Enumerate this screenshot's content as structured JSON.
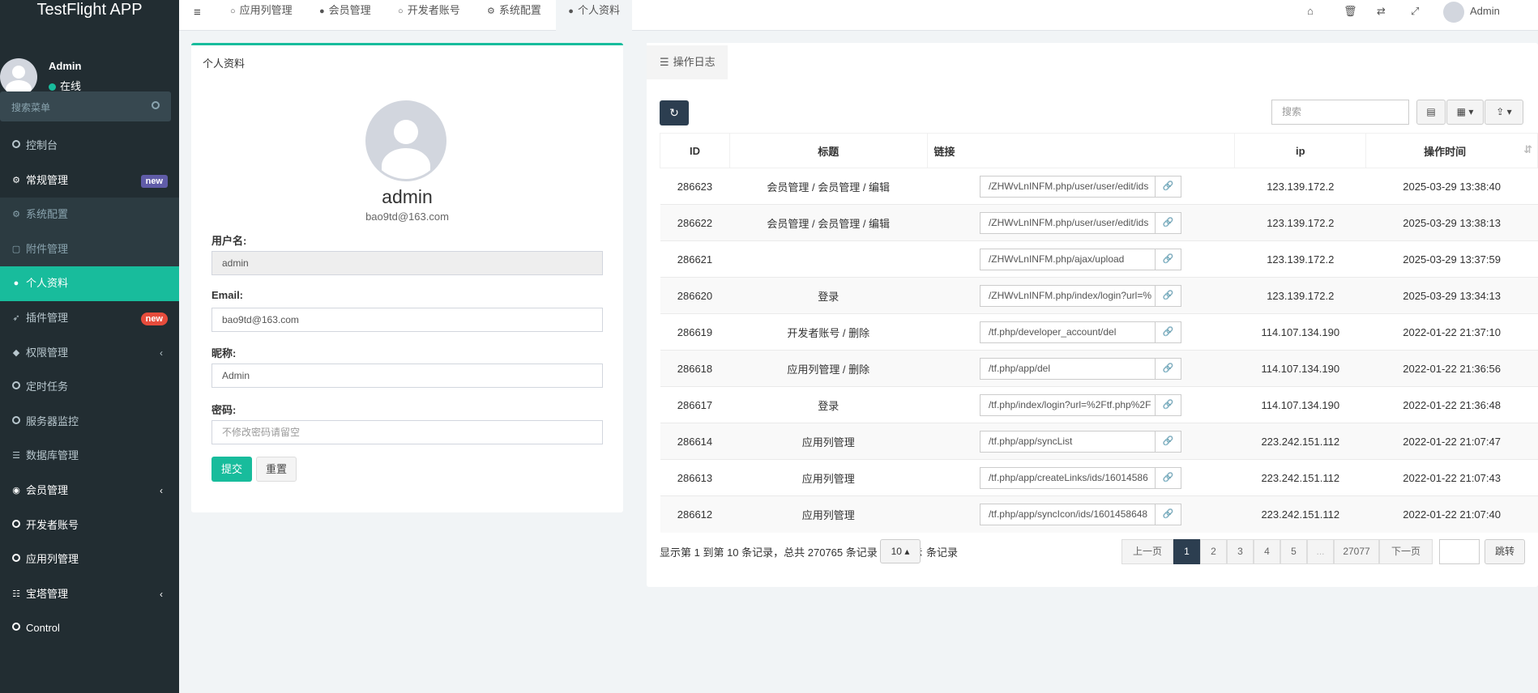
{
  "app": {
    "title": "TestFlight APP"
  },
  "user": {
    "name": "Admin",
    "status": "在线"
  },
  "sidebar": {
    "search_placeholder": "搜索菜单",
    "items": [
      {
        "label": "控制台"
      },
      {
        "label": "常规管理",
        "badge": "new"
      },
      {
        "label": "系统配置"
      },
      {
        "label": "附件管理"
      },
      {
        "label": "个人资料"
      },
      {
        "label": "插件管理",
        "badge": "new"
      },
      {
        "label": "权限管理"
      },
      {
        "label": "定时任务"
      },
      {
        "label": "服务器监控"
      },
      {
        "label": "数据库管理"
      },
      {
        "label": "会员管理"
      },
      {
        "label": "开发者账号"
      },
      {
        "label": "应用列管理"
      },
      {
        "label": "宝塔管理"
      },
      {
        "label": "Control"
      }
    ]
  },
  "tabs": [
    "应用列管理",
    "会员管理",
    "开发者账号",
    "系统配置",
    "个人资料"
  ],
  "topbar": {
    "username": "Admin"
  },
  "profile": {
    "header": "个人资料",
    "display_name": "admin",
    "email_caption": "bao9td@163.com",
    "fields": {
      "username_label": "用户名:",
      "username_value": "admin",
      "email_label": "Email:",
      "email_value": "bao9td@163.com",
      "nickname_label": "昵称:",
      "nickname_value": "Admin",
      "password_label": "密码:",
      "password_placeholder": "不修改密码请留空"
    },
    "submit_label": "提交",
    "reset_label": "重置"
  },
  "log": {
    "tab_label": "操作日志",
    "search_placeholder": "搜索",
    "columns": [
      "ID",
      "标题",
      "链接",
      "ip",
      "操作时间"
    ],
    "rows": [
      {
        "id": "286623",
        "title": "会员管理 / 会员管理 / 编辑",
        "url": "/ZHWvLnINFM.php/user/user/edit/ids",
        "ip": "123.139.172.2",
        "time": "2025-03-29 13:38:40"
      },
      {
        "id": "286622",
        "title": "会员管理 / 会员管理 / 编辑",
        "url": "/ZHWvLnINFM.php/user/user/edit/ids",
        "ip": "123.139.172.2",
        "time": "2025-03-29 13:38:13"
      },
      {
        "id": "286621",
        "title": "",
        "url": "/ZHWvLnINFM.php/ajax/upload",
        "ip": "123.139.172.2",
        "time": "2025-03-29 13:37:59"
      },
      {
        "id": "286620",
        "title": "登录",
        "url": "/ZHWvLnINFM.php/index/login?url=%",
        "ip": "123.139.172.2",
        "time": "2025-03-29 13:34:13"
      },
      {
        "id": "286619",
        "title": "开发者账号 / 删除",
        "url": "/tf.php/developer_account/del",
        "ip": "114.107.134.190",
        "time": "2022-01-22 21:37:10"
      },
      {
        "id": "286618",
        "title": "应用列管理 / 删除",
        "url": "/tf.php/app/del",
        "ip": "114.107.134.190",
        "time": "2022-01-22 21:36:56"
      },
      {
        "id": "286617",
        "title": "登录",
        "url": "/tf.php/index/login?url=%2Ftf.php%2F",
        "ip": "114.107.134.190",
        "time": "2022-01-22 21:36:48"
      },
      {
        "id": "286614",
        "title": "应用列管理",
        "url": "/tf.php/app/syncList",
        "ip": "223.242.151.112",
        "time": "2022-01-22 21:07:47"
      },
      {
        "id": "286613",
        "title": "应用列管理",
        "url": "/tf.php/app/createLinks/ids/16014586",
        "ip": "223.242.151.112",
        "time": "2022-01-22 21:07:43"
      },
      {
        "id": "286612",
        "title": "应用列管理",
        "url": "/tf.php/app/syncIcon/ids/1601458648",
        "ip": "223.242.151.112",
        "time": "2022-01-22 21:07:40"
      }
    ],
    "pager": {
      "info": "显示第 1 到第 10 条记录，总共 270765 条记录 每页显示",
      "page_size": "10",
      "records_suffix": "条记录",
      "prev": "上一页",
      "pages": [
        "1",
        "2",
        "3",
        "4",
        "5",
        "...",
        "27077"
      ],
      "next": "下一页",
      "jump": "跳转"
    }
  },
  "colors": {
    "accent": "#18bc9c",
    "sidebar": "#222d32",
    "dark_button": "#2c3e50",
    "badge_purple": "#605ca8",
    "badge_red": "#e74c3c",
    "link": "#337ab7"
  }
}
